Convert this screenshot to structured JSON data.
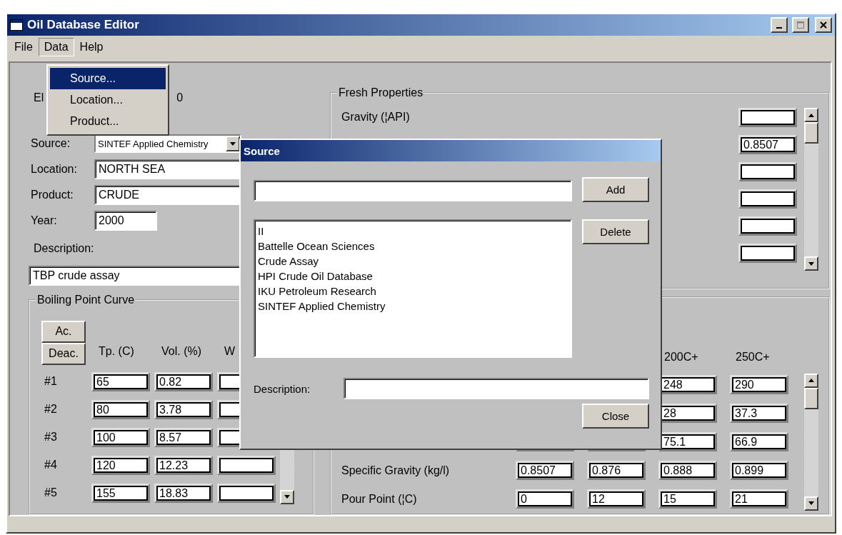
{
  "window": {
    "title": "Oil Database Editor"
  },
  "menu_bar": [
    {
      "label": "File",
      "selected": false
    },
    {
      "label": "Data",
      "selected": true
    },
    {
      "label": "Help",
      "selected": false
    }
  ],
  "open_menu": [
    {
      "label": "Source...",
      "selected": true
    },
    {
      "label": "Location...",
      "selected": false
    },
    {
      "label": "Product...",
      "selected": false
    }
  ],
  "record": {
    "id_label": "El",
    "id_value": "0",
    "fields": [
      {
        "label": "Source:",
        "value": "SINTEF Applied Chemistry",
        "kind": "combo"
      },
      {
        "label": "Location:",
        "value": "NORTH SEA",
        "kind": "text"
      },
      {
        "label": "Product:",
        "value": "CRUDE",
        "kind": "text"
      },
      {
        "label": "Year:",
        "value": "2000",
        "kind": "short"
      }
    ],
    "description_label": "Description:",
    "description": "TBP crude assay"
  },
  "boiling_point_curve": {
    "title": "Boiling Point Curve",
    "buttons": [
      "Ac.",
      "Deac."
    ],
    "columns": [
      "Tp. (C)",
      "Vol. (%)",
      "W"
    ],
    "rows": [
      {
        "label": "#1",
        "cells": [
          "65",
          "0.82",
          null
        ]
      },
      {
        "label": "#2",
        "cells": [
          "80",
          "3.78",
          null
        ]
      },
      {
        "label": "#3",
        "cells": [
          "100",
          "8.57",
          null
        ]
      },
      {
        "label": "#4",
        "cells": [
          "120",
          "12.23",
          null
        ]
      },
      {
        "label": "#5",
        "cells": [
          "155",
          "18.83",
          null
        ]
      }
    ]
  },
  "fresh_properties": {
    "title": "Fresh Properties",
    "rows": [
      {
        "label": "Gravity (¦API)",
        "value": null
      },
      {
        "label": null,
        "value": "0.8507"
      },
      {
        "label": null,
        "value": null
      },
      {
        "label": null,
        "value": null
      },
      {
        "label": null,
        "value": null
      },
      {
        "label": null,
        "value": null
      }
    ]
  },
  "fraction_properties": {
    "columns": [
      null,
      null,
      "200C+",
      "250C+"
    ],
    "rows": [
      {
        "label": null,
        "cells": [
          null,
          null,
          "248",
          "290"
        ]
      },
      {
        "label": null,
        "cells": [
          null,
          null,
          "28",
          "37.3"
        ]
      },
      {
        "label": null,
        "cells": [
          null,
          null,
          "75.1",
          "66.9"
        ]
      },
      {
        "label": "Specific Gravity (kg/l)",
        "cells": [
          "0.8507",
          "0.876",
          "0.888",
          "0.899"
        ]
      },
      {
        "label": "Pour Point (¦C)",
        "cells": [
          "0",
          "12",
          "15",
          "21"
        ]
      }
    ]
  },
  "dialog": {
    "title": "Source",
    "add_button": "Add",
    "delete_button": "Delete",
    "close_button": "Close",
    "list": [
      "II",
      "Battelle Ocean Sciences",
      "Crude Assay",
      "HPI Crude Oil Database",
      "IKU Petroleum Research",
      "SINTEF Applied Chemistry"
    ],
    "description_label": "Description:"
  }
}
